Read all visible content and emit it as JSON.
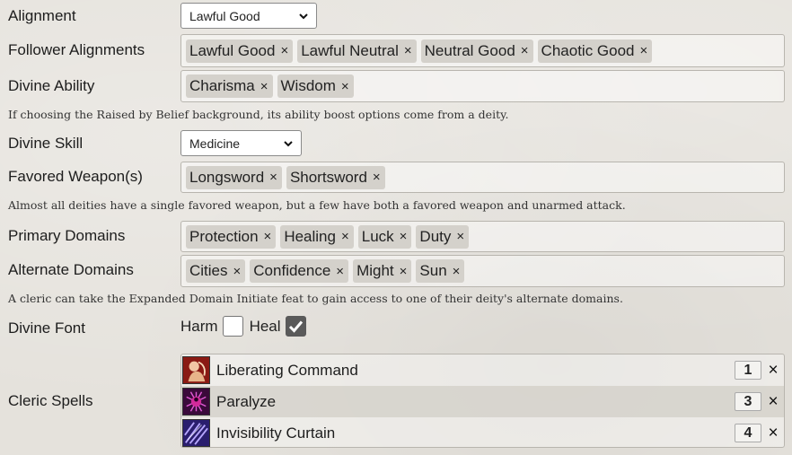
{
  "alignment": {
    "label": "Alignment",
    "value": "Lawful Good"
  },
  "follower_alignments": {
    "label": "Follower Alignments",
    "tags": [
      "Lawful Good",
      "Lawful Neutral",
      "Neutral Good",
      "Chaotic Good"
    ]
  },
  "divine_ability": {
    "label": "Divine Ability",
    "tags": [
      "Charisma",
      "Wisdom"
    ],
    "hint": "If choosing the Raised by Belief background, its ability boost options come from a deity."
  },
  "divine_skill": {
    "label": "Divine Skill",
    "value": "Medicine"
  },
  "favored_weapons": {
    "label": "Favored Weapon(s)",
    "tags": [
      "Longsword",
      "Shortsword"
    ],
    "hint": "Almost all deities have a single favored weapon, but a few have both a favored weapon and unarmed attack."
  },
  "primary_domains": {
    "label": "Primary Domains",
    "tags": [
      "Protection",
      "Healing",
      "Luck",
      "Duty"
    ]
  },
  "alternate_domains": {
    "label": "Alternate Domains",
    "tags": [
      "Cities",
      "Confidence",
      "Might",
      "Sun"
    ],
    "hint": "A cleric can take the Expanded Domain Initiate feat to gain access to one of their deity's alternate domains."
  },
  "divine_font": {
    "label": "Divine Font",
    "harm_label": "Harm",
    "harm_checked": false,
    "heal_label": "Heal",
    "heal_checked": true
  },
  "cleric_spells": {
    "label": "Cleric Spells",
    "items": [
      {
        "name": "Liberating Command",
        "rank": "1"
      },
      {
        "name": "Paralyze",
        "rank": "3"
      },
      {
        "name": "Invisibility Curtain",
        "rank": "4"
      }
    ]
  },
  "icons": {
    "remove": "×",
    "chevron": "chevron-down-icon",
    "check": "check-icon"
  }
}
